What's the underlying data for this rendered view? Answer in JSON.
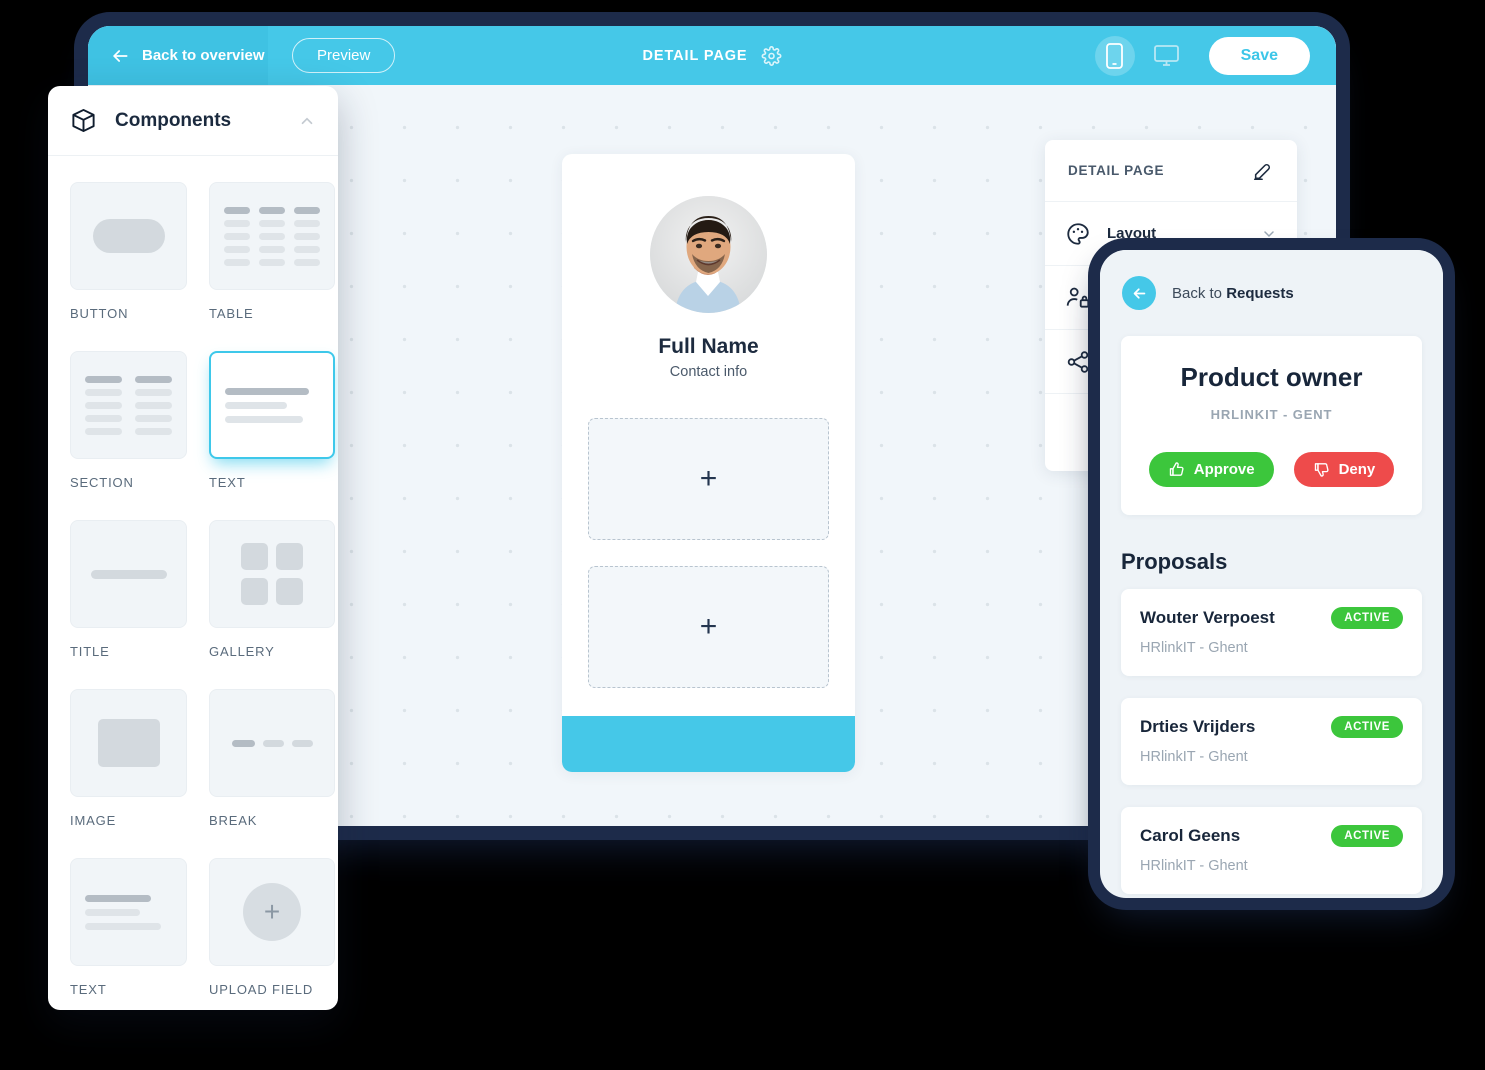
{
  "builder": {
    "topbar": {
      "back_label": "Back to overview",
      "preview_label": "Preview",
      "page_title": "DETAIL PAGE",
      "save_label": "Save",
      "accent_color": "#45c8e8",
      "icons": [
        "arrow-left-icon",
        "gear-icon",
        "mobile-device-icon",
        "desktop-device-icon"
      ]
    },
    "detail_card": {
      "name": "Full Name",
      "contact": "Contact info",
      "placeholder_glyph": "+",
      "drop_zones": 2
    },
    "settings_panel": {
      "title": "DETAIL PAGE",
      "edit_icon": "edit-pencil-icon",
      "rows": [
        {
          "label": "Layout",
          "icon": "palette-icon",
          "chevron": "chevron-down-icon"
        },
        {
          "label": "",
          "icon": "user-lock-icon",
          "chevron": ""
        },
        {
          "label": "",
          "icon": "share-icon",
          "chevron": ""
        }
      ]
    }
  },
  "components_panel": {
    "title": "Components",
    "header_icon": "cube-icon",
    "collapse_icon": "chevron-up-icon",
    "items": [
      {
        "label": "BUTTON",
        "thumb": "button",
        "selected": false
      },
      {
        "label": "TABLE",
        "thumb": "table",
        "selected": false
      },
      {
        "label": "SECTION",
        "thumb": "section",
        "selected": false
      },
      {
        "label": "TEXT",
        "thumb": "text",
        "selected": true
      },
      {
        "label": "TITLE",
        "thumb": "title",
        "selected": false
      },
      {
        "label": "GALLERY",
        "thumb": "gallery",
        "selected": false
      },
      {
        "label": "IMAGE",
        "thumb": "image",
        "selected": false
      },
      {
        "label": "BREAK",
        "thumb": "break",
        "selected": false
      },
      {
        "label": "TEXT",
        "thumb": "text2",
        "selected": false
      },
      {
        "label": "UPLOAD FIELD",
        "thumb": "upload",
        "selected": false
      }
    ]
  },
  "mobile_preview": {
    "back_prefix": "Back to ",
    "back_target": "Requests",
    "back_icon": "arrow-left-circle-icon",
    "job": {
      "title": "Product owner",
      "company": "HRLINKIT  - GENT",
      "approve_label": "Approve",
      "deny_label": "Deny",
      "approve_icon": "thumbs-up-icon",
      "deny_icon": "thumbs-down-icon",
      "approve_color": "#3cc63c",
      "deny_color": "#ee4b4b"
    },
    "proposals_title": "Proposals",
    "proposals": [
      {
        "name": "Wouter Verpoest",
        "org": "HRlinkIT - Ghent",
        "status": "ACTIVE"
      },
      {
        "name": "Drties Vrijders",
        "org": "HRlinkIT - Ghent",
        "status": "ACTIVE"
      },
      {
        "name": "Carol Geens",
        "org": "HRlinkIT - Ghent",
        "status": "ACTIVE"
      }
    ]
  }
}
